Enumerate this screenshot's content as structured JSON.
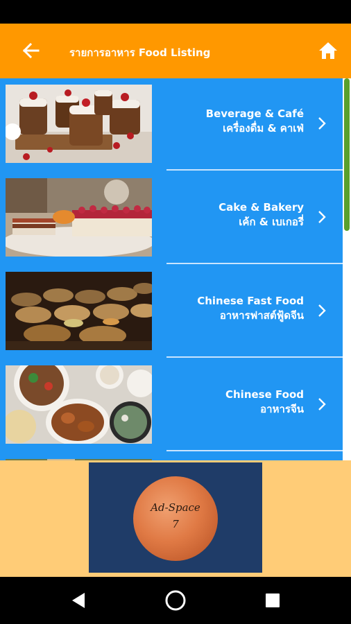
{
  "app_bar": {
    "title": "รายการอาหาร Food Listing",
    "color": "#ff9800",
    "back_icon": "arrow-left-icon",
    "home_icon": "home-icon"
  },
  "list": {
    "background": "#2196f3",
    "items": [
      {
        "title_en": "Beverage & Café",
        "title_th": "เครื่องดื่ม & คาเฟ่",
        "image": "chocolate-desserts-photo"
      },
      {
        "title_en": "Cake & Bakery",
        "title_th": "เค้ก & เบเกอรี่",
        "image": "raspberry-cake-photo"
      },
      {
        "title_en": "Chinese Fast Food",
        "title_th": "อาหารฟาสต์ฟู้ดจีน",
        "image": "dim-sum-steamers-photo"
      },
      {
        "title_en": "Chinese Food",
        "title_th": "อาหารจีน",
        "image": "chinese-dishes-photo"
      }
    ]
  },
  "ad": {
    "line1": "Ad-Space",
    "line2": "7",
    "background": "#ffcc77"
  },
  "nav": {
    "back_icon": "triangle-back-icon",
    "home_icon": "circle-home-icon",
    "recents_icon": "square-recents-icon"
  }
}
